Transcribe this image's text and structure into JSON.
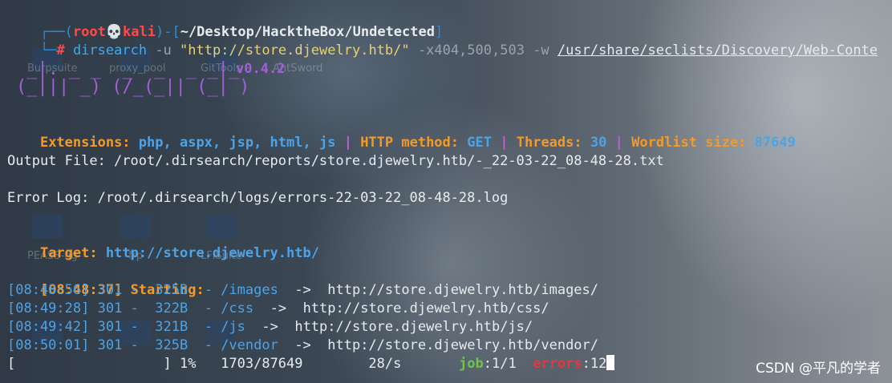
{
  "prompt": {
    "open_bracket": "┌──(",
    "user": "root",
    "skull": "💀",
    "host": "kali",
    "mid": ")-[",
    "cwd": "~/Desktop/HacktheBox/Undetected",
    "close": "]",
    "hash_prefix": "└─",
    "hash": "#"
  },
  "command": {
    "program": "dirsearch",
    "flag_u": "-u",
    "url": "\"http://store.djewelry.htb/\"",
    "flag_x": "-x404,500,503",
    "flag_w": "-w",
    "wordlist_path": "/usr/share/seclists/Discovery/Web-Conte"
  },
  "banner": {
    "art_line1": " _|. _ _  _  _  _ _|_",
    "art_line2": "(_||| _) (/_(_|| (_| )",
    "version": "v0.4.2"
  },
  "config": {
    "extensions_label": "Extensions:",
    "extensions_value": "php, aspx, jsp, html, js",
    "sep": "|",
    "http_label": "HTTP method:",
    "http_value": "GET",
    "threads_label": "Threads:",
    "threads_value": "30",
    "wordlist_label": "Wordlist size:",
    "wordlist_value": "87649"
  },
  "output_file": "Output File: /root/.dirsearch/reports/store.djewelry.htb/-_22-03-22_08-48-28.txt",
  "error_log": "Error Log: /root/.dirsearch/logs/errors-22-03-22_08-48-28.log",
  "target": {
    "label": "Target:",
    "value": "http://store.djewelry.htb/"
  },
  "start": {
    "time": "[08:48:37]",
    "label": "Starting:"
  },
  "results": [
    {
      "time": "[08:48:56]",
      "status": "301 -",
      "size": "  325B",
      "dash": "  -",
      "path": "/images",
      "arrow": "  ->  ",
      "redirect": "http://store.djewelry.htb/images/"
    },
    {
      "time": "[08:49:28]",
      "status": "301 -",
      "size": "  322B",
      "dash": "  -",
      "path": "/css",
      "arrow": "  ->  ",
      "redirect": "http://store.djewelry.htb/css/"
    },
    {
      "time": "[08:49:42]",
      "status": "301 -",
      "size": "  321B",
      "dash": "  -",
      "path": "/js",
      "arrow": "  ->  ",
      "redirect": "http://store.djewelry.htb/js/"
    },
    {
      "time": "[08:50:01]",
      "status": "301 -",
      "size": "  325B",
      "dash": "  -",
      "path": "/vendor",
      "arrow": "  ->  ",
      "redirect": "http://store.djewelry.htb/vendor/"
    }
  ],
  "progress": {
    "bar": "[                  ]",
    "percent": "1%",
    "count": "1703/87649",
    "rate": "28/s",
    "job_label": "job",
    "job_value": ":1/1",
    "errors_label": "errors",
    "errors_value": ":12"
  },
  "watermark": "CSDN @平凡的学者",
  "desktop_labels": [
    "Burpsuite",
    "proxy_pool",
    "GitTools",
    "AntSword",
    "PEASS-ng",
    "frp",
    "LFISuite"
  ]
}
